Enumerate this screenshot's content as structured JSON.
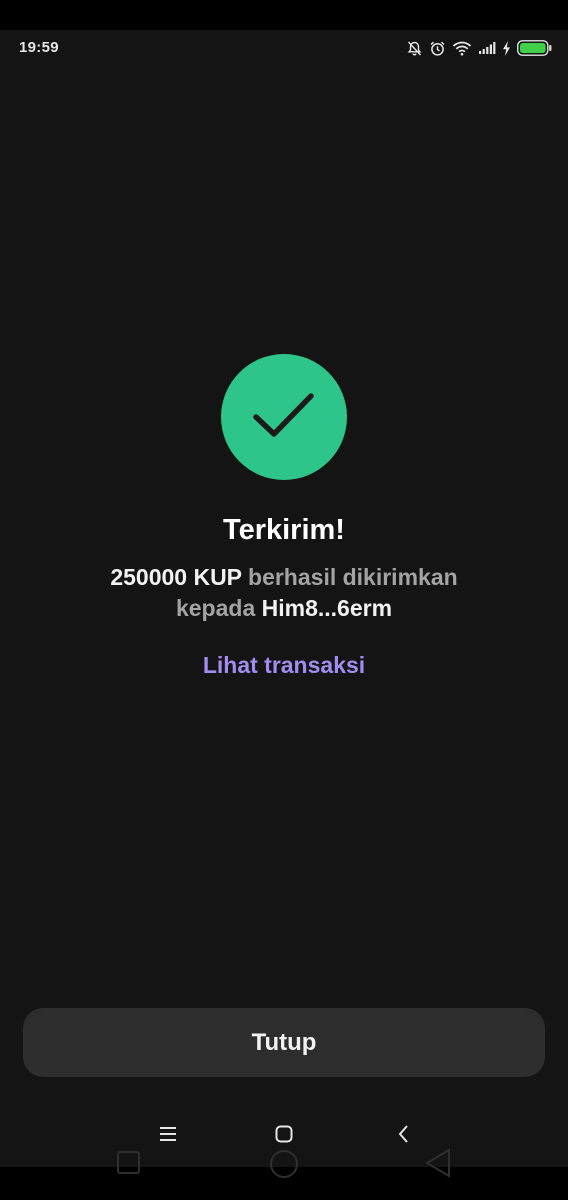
{
  "status_bar": {
    "time": "19:59",
    "icons": [
      "bell-muted-icon",
      "alarm-icon",
      "wifi-icon",
      "signal-icon",
      "charging-icon",
      "battery-icon"
    ],
    "battery_color": "#3fd14a"
  },
  "success": {
    "icon": "check-circle-icon",
    "icon_color": "#2dc58a",
    "title": "Terkirim!",
    "amount": "250000 KUP",
    "message_middle": "berhasil dikirimkan",
    "message_to": "kepada",
    "recipient": "Him8...6erm",
    "view_link": "Lihat transaksi",
    "link_color": "#a18cf0"
  },
  "actions": {
    "close_label": "Tutup"
  },
  "nav_bar": {
    "buttons": [
      "menu-icon",
      "home-icon",
      "back-icon"
    ]
  }
}
